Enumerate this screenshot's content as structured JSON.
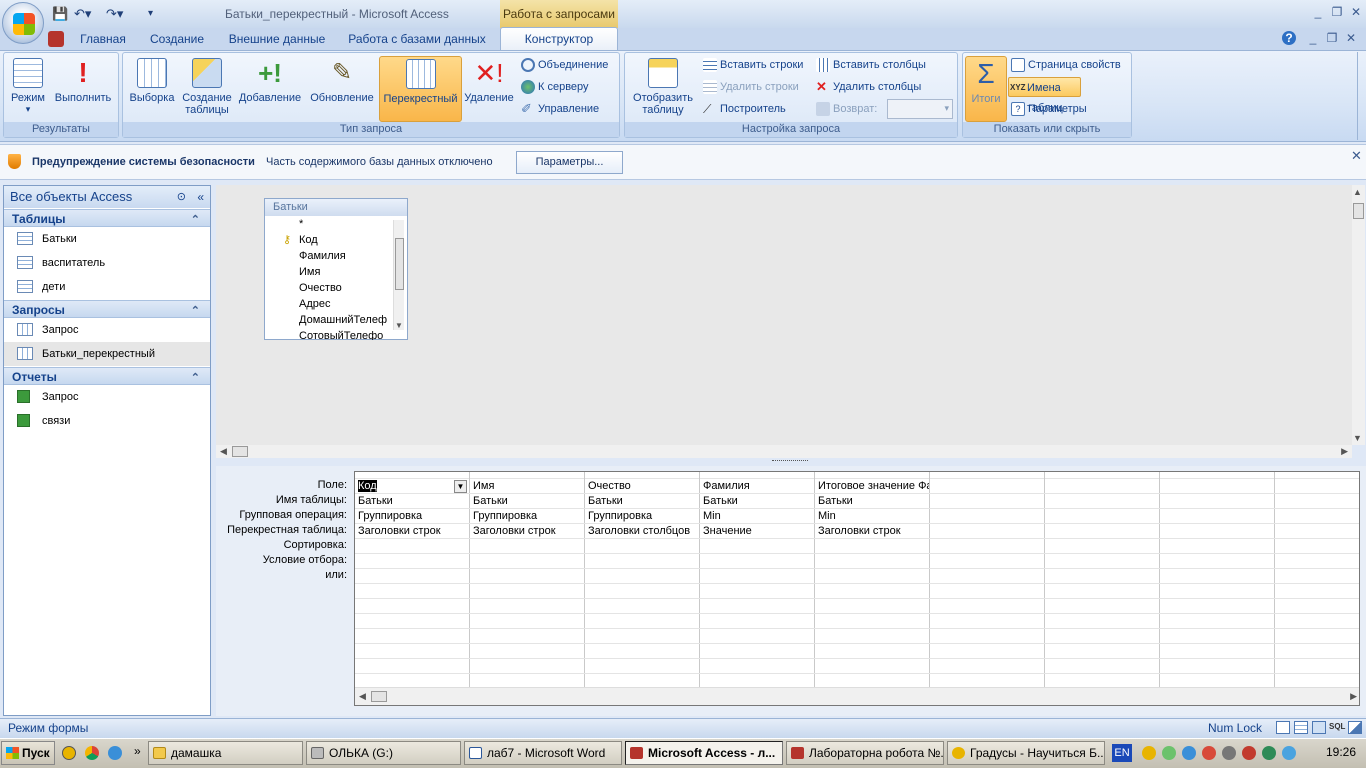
{
  "window": {
    "title": "Батьки_перекрестный - Microsoft Access",
    "context_tab_title": "Работа с запросами"
  },
  "tabs": [
    "Главная",
    "Создание",
    "Внешние данные",
    "Работа с базами данных"
  ],
  "active_tab": "Конструктор",
  "ribbon": {
    "results": {
      "label": "Результаты",
      "mode": "Режим",
      "run": "Выполнить"
    },
    "query_type": {
      "label": "Тип запроса",
      "select": "Выборка",
      "make_table_1": "Создание",
      "make_table_2": "таблицы",
      "append": "Добавление",
      "update": "Обновление",
      "crosstab": "Перекрестный",
      "delete": "Удаление",
      "union": "Объединение",
      "pass_through": "К серверу",
      "data_definition": "Управление"
    },
    "setup": {
      "label": "Настройка запроса",
      "show_table_1": "Отобразить",
      "show_table_2": "таблицу",
      "insert_rows": "Вставить строки",
      "delete_rows": "Удалить строки",
      "builder": "Построитель",
      "insert_columns": "Вставить столбцы",
      "delete_columns": "Удалить столбцы",
      "return": "Возврат:"
    },
    "show_hide": {
      "label": "Показать или скрыть",
      "totals": "Итоги",
      "property_sheet": "Страница свойств",
      "table_names": "Имена таблиц",
      "parameters": "Параметры"
    }
  },
  "security": {
    "title": "Предупреждение системы безопасности",
    "message": "Часть содержимого базы данных отключено",
    "button": "Параметры..."
  },
  "nav": {
    "header": "Все объекты Access",
    "sections": [
      {
        "title": "Таблицы",
        "items": [
          "Батьки",
          "васпитатель",
          "дети"
        ]
      },
      {
        "title": "Запросы",
        "items": [
          "Запрос",
          "Батьки_перекрестный"
        ]
      },
      {
        "title": "Отчеты",
        "items": [
          "Запрос",
          "связи"
        ]
      }
    ]
  },
  "table_box": {
    "title": "Батьки",
    "fields": [
      "*",
      "Код",
      "Фамилия",
      "Имя",
      "Очество",
      "Адрес",
      "ДомашнийТелеф",
      "СотовыйТелефо"
    ]
  },
  "grid": {
    "row_labels": [
      "Поле:",
      "Имя таблицы:",
      "Групповая операция:",
      "Перекрестная таблица:",
      "Сортировка:",
      "Условие отбора:",
      "или:"
    ],
    "columns": [
      {
        "field": "Код",
        "table": "Батьки",
        "group": "Группировка",
        "crosstab": "Заголовки строк"
      },
      {
        "field": "Имя",
        "table": "Батьки",
        "group": "Группировка",
        "crosstab": "Заголовки строк"
      },
      {
        "field": "Очество",
        "table": "Батьки",
        "group": "Группировка",
        "crosstab": "Заголовки столбцов"
      },
      {
        "field": "Фамилия",
        "table": "Батьки",
        "group": "Min",
        "crosstab": "Значение"
      },
      {
        "field": "Итоговое значение Фамилия",
        "table": "Батьки",
        "group": "Min",
        "crosstab": "Заголовки строк"
      }
    ]
  },
  "status": {
    "left": "Режим формы",
    "right": "Num Lock"
  },
  "taskbar": {
    "start": "Пуск",
    "items": [
      "дамашка",
      "ОЛЬКА (G:)",
      "лаб7 - Microsoft Word",
      "Microsoft Access - л...",
      "Лабораторна робота №...",
      "Градусы - Научиться Б..."
    ],
    "lang": "EN",
    "clock": "19:26"
  }
}
